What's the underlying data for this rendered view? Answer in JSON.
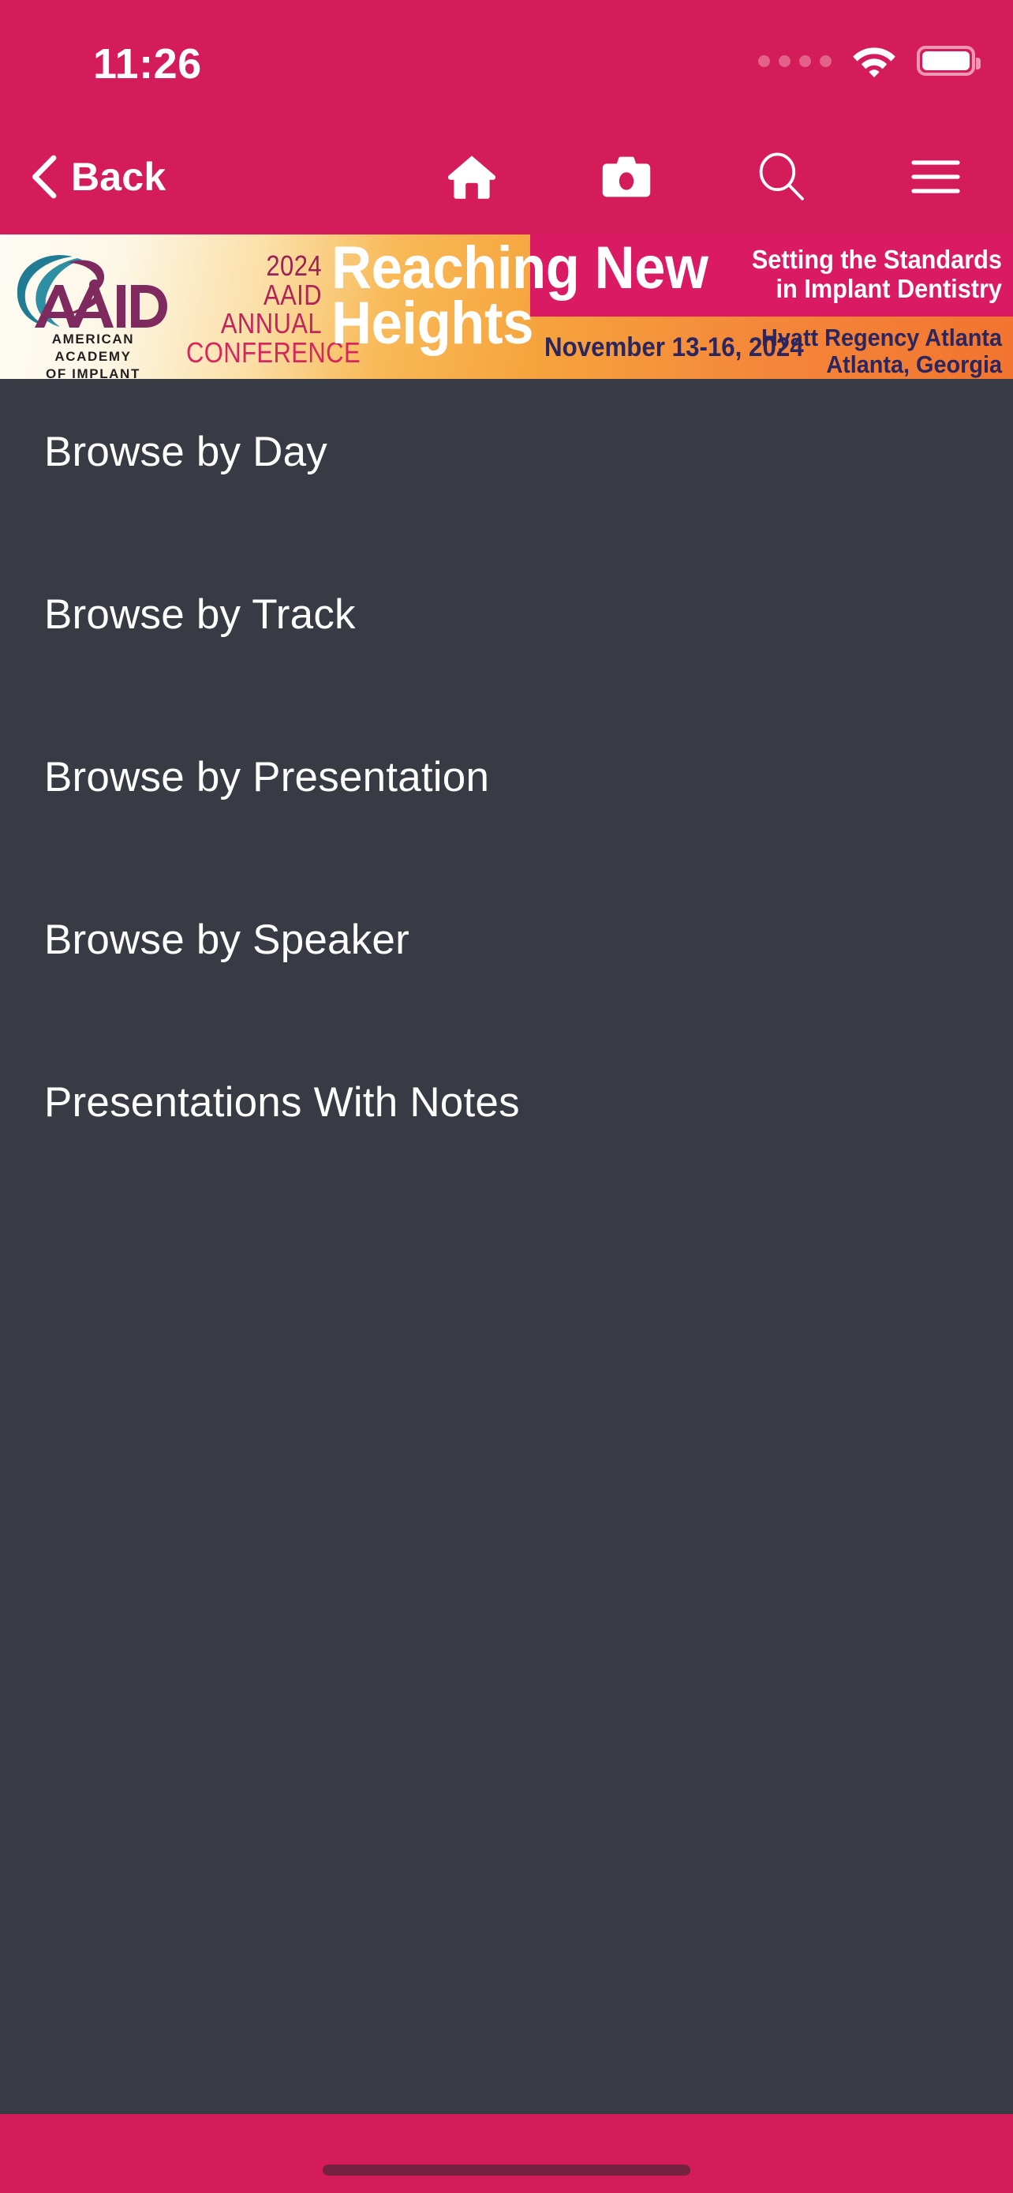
{
  "status_bar": {
    "time": "11:26",
    "signal_icon": "signal-dots-icon",
    "wifi_icon": "wifi-icon",
    "battery_icon": "battery-full-icon"
  },
  "nav_bar": {
    "back_label": "Back",
    "back_icon": "chevron-left-icon",
    "icons": [
      {
        "name": "home-icon",
        "label": "Home"
      },
      {
        "name": "camera-icon",
        "label": "Camera"
      },
      {
        "name": "search-icon",
        "label": "Search"
      },
      {
        "name": "hamburger-menu-icon",
        "label": "Menu"
      }
    ]
  },
  "banner": {
    "logo": {
      "mark_alt": "AAID logo",
      "org_line_1": "AMERICAN ACADEMY",
      "org_line_2": "OF IMPLANT DENTISTRY"
    },
    "conference_lines": [
      "2024",
      "AAID",
      "ANNUAL",
      "CONFERENCE"
    ],
    "headline_line_1": "Reaching New",
    "headline_line_2": "Heights",
    "dates": "November 13-16, 2024",
    "tagline_line_1": "Setting the Standards",
    "tagline_line_2": "in Implant Dentistry",
    "venue_line_1": "Hyatt Regency Atlanta",
    "venue_line_2": "Atlanta, Georgia"
  },
  "menu": {
    "items": [
      {
        "label": "Browse by Day"
      },
      {
        "label": "Browse by Track"
      },
      {
        "label": "Browse by Presentation"
      },
      {
        "label": "Browse by Speaker"
      },
      {
        "label": "Presentations With Notes"
      }
    ]
  },
  "bottom_bar": {
    "home_indicator": "home-indicator"
  },
  "colors": {
    "brand_crimson": "#D41C5B",
    "banner_pink": "#DA1A63",
    "banner_orange": "#F6A43D",
    "banner_orange_deep": "#F2742F",
    "page_background": "#383A44",
    "text_primary": "#FFFFFF",
    "navy_text": "#2B2560",
    "logo_teal": "#1F7C92",
    "logo_purple": "#7E2A5E"
  }
}
